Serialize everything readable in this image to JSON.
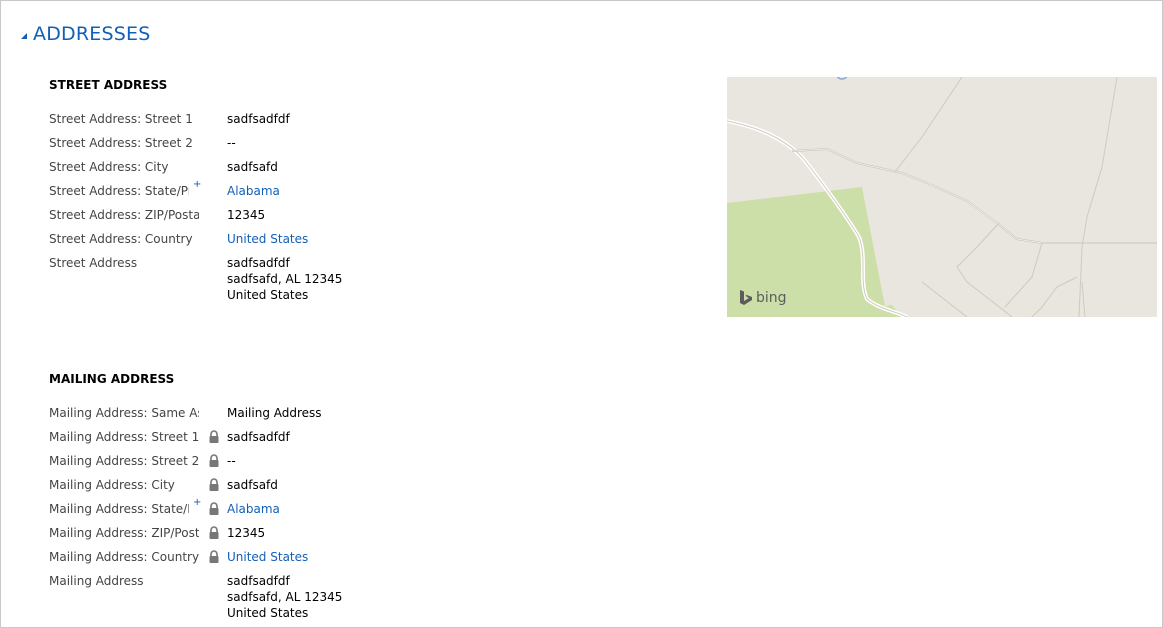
{
  "section": {
    "title": "ADDRESSES"
  },
  "street": {
    "title": "STREET ADDRESS",
    "fields": [
      {
        "label": "Street Address: Street 1",
        "value": "sadfsadfdf"
      },
      {
        "label": "Street Address: Street 2",
        "value": "--"
      },
      {
        "label": "Street Address: City",
        "value": "sadfsafd"
      },
      {
        "label": "Street Address: State/Province",
        "value": "Alabama",
        "required": "+"
      },
      {
        "label": "Street Address: ZIP/Postal Code",
        "value": "12345"
      },
      {
        "label": "Street Address: Country",
        "value": "United States"
      },
      {
        "label": "Street Address",
        "lines": [
          "sadfsadfdf",
          "sadfsafd, AL 12345",
          "United States"
        ]
      }
    ]
  },
  "mailing": {
    "title": "MAILING ADDRESS",
    "fields": [
      {
        "label": "Mailing Address: Same As",
        "value": "Mailing Address"
      },
      {
        "label": "Mailing Address: Street 1",
        "value": "sadfsadfdf"
      },
      {
        "label": "Mailing Address: Street 2",
        "value": "--"
      },
      {
        "label": "Mailing Address: City",
        "value": "sadfsafd"
      },
      {
        "label": "Mailing Address: State/Province",
        "value": "Alabama",
        "required": "+"
      },
      {
        "label": "Mailing Address: ZIP/Postal Code",
        "value": "12345"
      },
      {
        "label": "Mailing Address: Country",
        "value": "United States"
      },
      {
        "label": "Mailing Address",
        "lines": [
          "sadfsadfdf",
          "sadfsafd, AL 12345",
          "United States"
        ]
      }
    ]
  },
  "map": {
    "provider": "bing"
  },
  "colors": {
    "accent": "#1160b7",
    "map_bg": "#e9e6e0",
    "map_park": "#cddfa8"
  }
}
